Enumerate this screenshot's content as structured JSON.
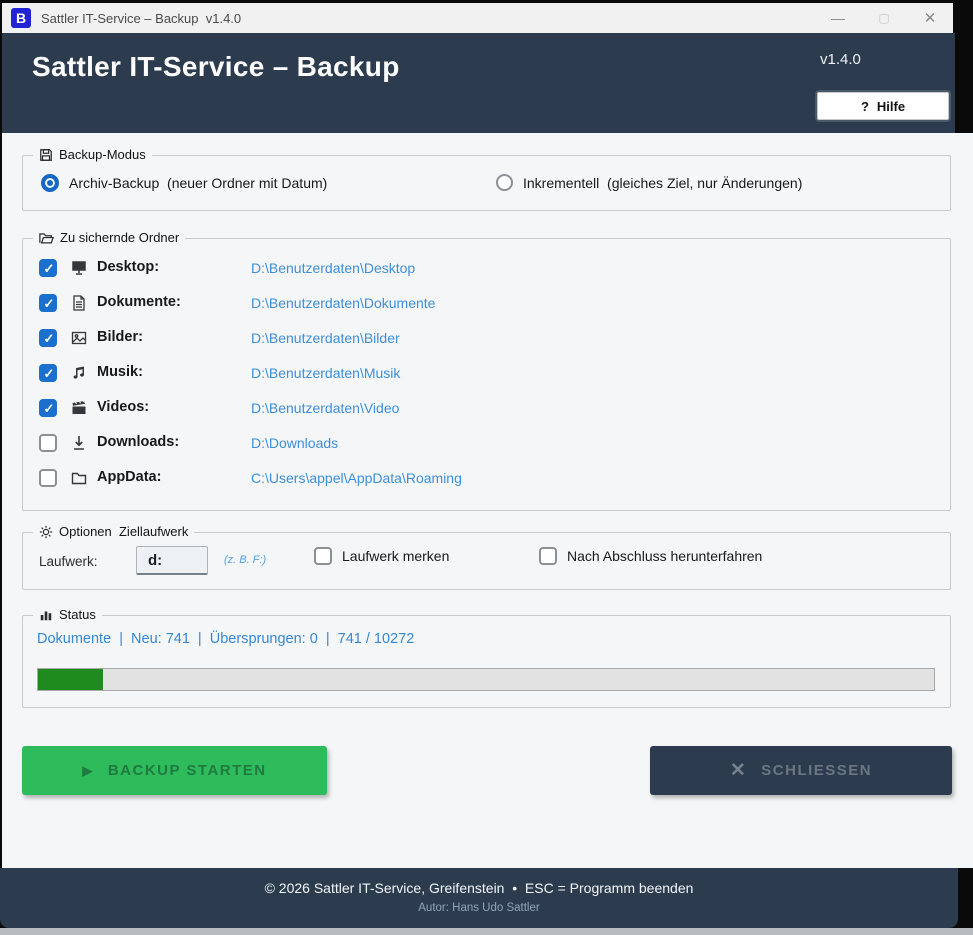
{
  "titlebar": {
    "app_initial": "B",
    "title": "Sattler IT-Service – Backup  v1.4.0",
    "minimize_glyph": "—",
    "maximize_glyph": "▢",
    "close_glyph": "✕"
  },
  "header": {
    "title": "Sattler IT-Service – Backup",
    "version": "v1.4.0",
    "help_icon": "?",
    "help_label": "Hilfe"
  },
  "backup_mode": {
    "group_label": "Backup-Modus",
    "options": [
      {
        "label": "Archiv-Backup  (neuer Ordner mit Datum)",
        "selected": true
      },
      {
        "label": "Inkrementell  (gleiches Ziel, nur Änderungen)",
        "selected": false
      }
    ]
  },
  "folders": {
    "group_label": "Zu sichernde Ordner",
    "items": [
      {
        "name": "Desktop:",
        "path": "D:\\Benutzerdaten\\Desktop",
        "checked": true,
        "icon": "desktop-icon"
      },
      {
        "name": "Dokumente:",
        "path": "D:\\Benutzerdaten\\Dokumente",
        "checked": true,
        "icon": "document-icon"
      },
      {
        "name": "Bilder:",
        "path": "D:\\Benutzerdaten\\Bilder",
        "checked": true,
        "icon": "picture-icon"
      },
      {
        "name": "Musik:",
        "path": "D:\\Benutzerdaten\\Musik",
        "checked": true,
        "icon": "music-icon"
      },
      {
        "name": "Videos:",
        "path": "D:\\Benutzerdaten\\Video",
        "checked": true,
        "icon": "video-icon"
      },
      {
        "name": "Downloads:",
        "path": "D:\\Downloads",
        "checked": false,
        "icon": "download-icon"
      },
      {
        "name": "AppData:",
        "path": "C:\\Users\\appel\\AppData\\Roaming",
        "checked": false,
        "icon": "folder-icon"
      }
    ]
  },
  "options": {
    "group_label": "Optionen  Ziellaufwerk",
    "drive_label": "Laufwerk:",
    "drive_value": "d:",
    "drive_hint": "(z. B. F:)",
    "checkboxes": [
      {
        "label": "Laufwerk merken",
        "checked": false
      },
      {
        "label": "Nach Abschluss herunterfahren",
        "checked": false
      }
    ]
  },
  "status": {
    "group_label": "Status",
    "text": "Dokumente  |  Neu: 741  |  Übersprungen: 0  |  741 / 10272",
    "folder": "Dokumente",
    "new_count": 741,
    "skipped_count": 0,
    "done_count": 741,
    "total_count": 10272,
    "progress_percent": 7.2
  },
  "actions": {
    "start_icon": "▶",
    "start_label": "BACKUP STARTEN",
    "close_icon": "✕",
    "close_label": "SCHLIESSEN"
  },
  "footer": {
    "line1": "© 2026 Sattler IT-Service, Greifenstein  •  ESC = Programm beenden",
    "line2": "Autor: Hans Udo Sattler"
  },
  "colors": {
    "header_bg": "#2c3c4e",
    "accent_blue": "#1a70cc",
    "path_blue": "#3d8fd9",
    "start_green": "#2dbb5c",
    "progress_green": "#1f8b1f"
  }
}
